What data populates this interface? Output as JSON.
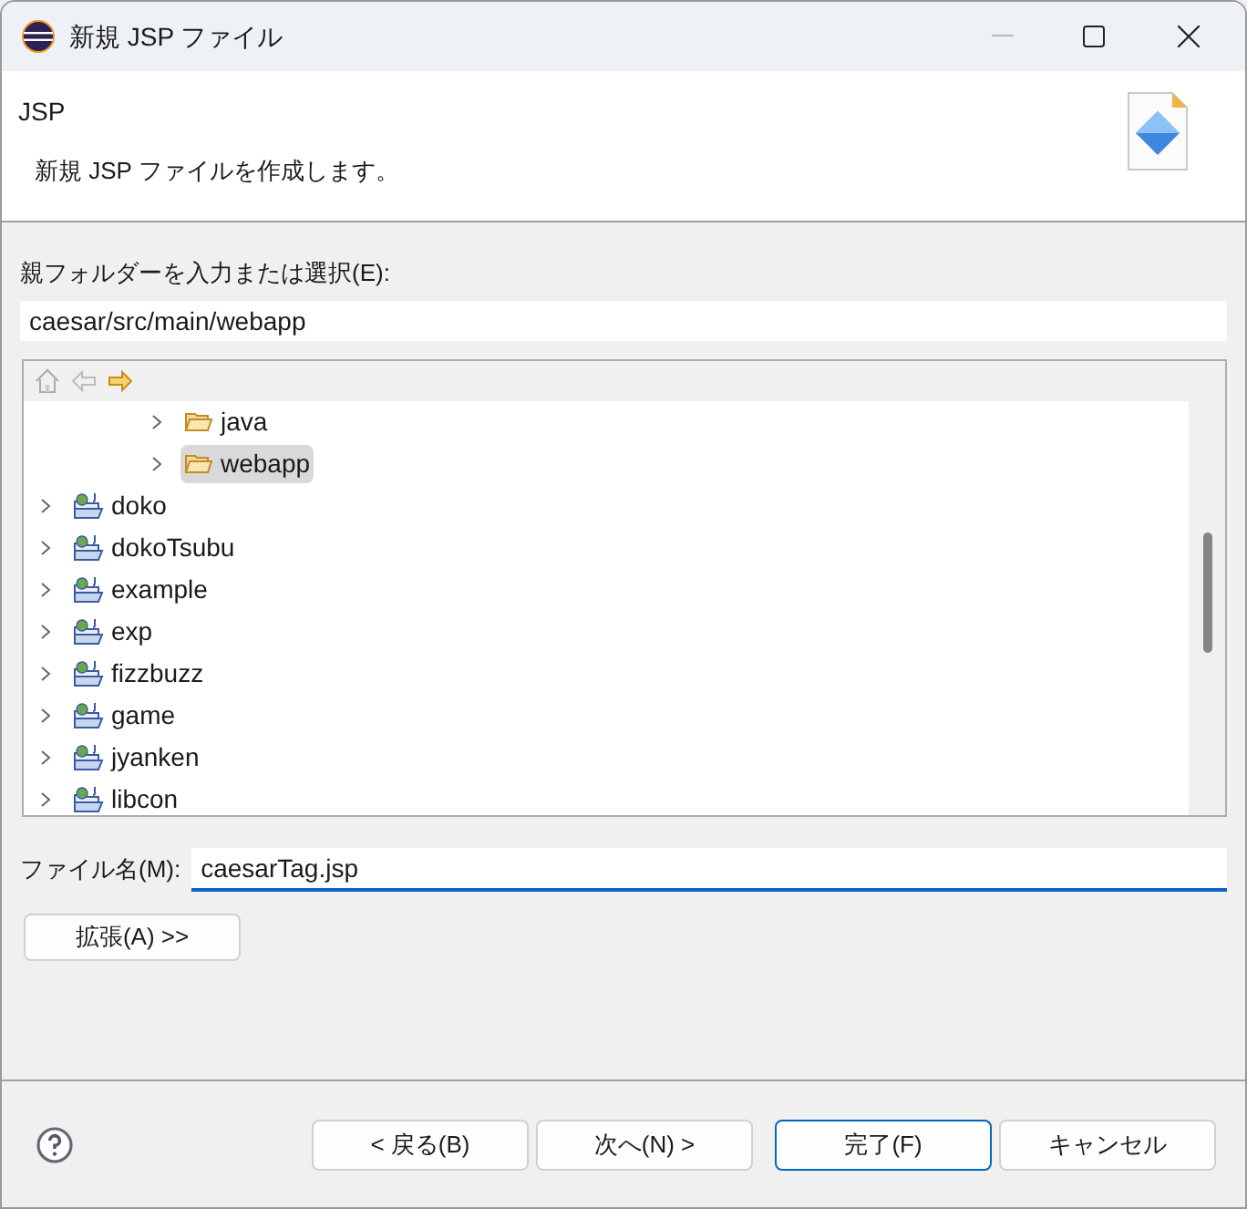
{
  "window": {
    "title": "新規 JSP ファイル"
  },
  "header": {
    "title": "JSP",
    "description": "新規 JSP ファイルを作成します。"
  },
  "folder": {
    "label": "親フォルダーを入力または選択(E):",
    "value": "caesar/src/main/webapp"
  },
  "tree": {
    "nested_items": [
      {
        "label": "java",
        "kind": "folder",
        "selected": false
      },
      {
        "label": "webapp",
        "kind": "folder",
        "selected": true
      }
    ],
    "items": [
      {
        "label": "doko",
        "kind": "project",
        "selected": false
      },
      {
        "label": "dokoTsubu",
        "kind": "project",
        "selected": false
      },
      {
        "label": "example",
        "kind": "project",
        "selected": false
      },
      {
        "label": "exp",
        "kind": "project",
        "selected": false
      },
      {
        "label": "fizzbuzz",
        "kind": "project",
        "selected": false
      },
      {
        "label": "game",
        "kind": "project",
        "selected": false
      },
      {
        "label": "jyanken",
        "kind": "project",
        "selected": false
      },
      {
        "label": "libcon",
        "kind": "project",
        "selected": false
      }
    ]
  },
  "file_name": {
    "label": "ファイル名(M):",
    "value": "caesarTag.jsp"
  },
  "advanced_button": "拡張(A) >>",
  "buttons": [
    {
      "label": "< 戻る(B)",
      "default": false
    },
    {
      "label": "次へ(N) >",
      "default": false
    },
    {
      "label": "完了(F)",
      "default": true
    },
    {
      "label": "キャンセル",
      "default": false
    }
  ]
}
